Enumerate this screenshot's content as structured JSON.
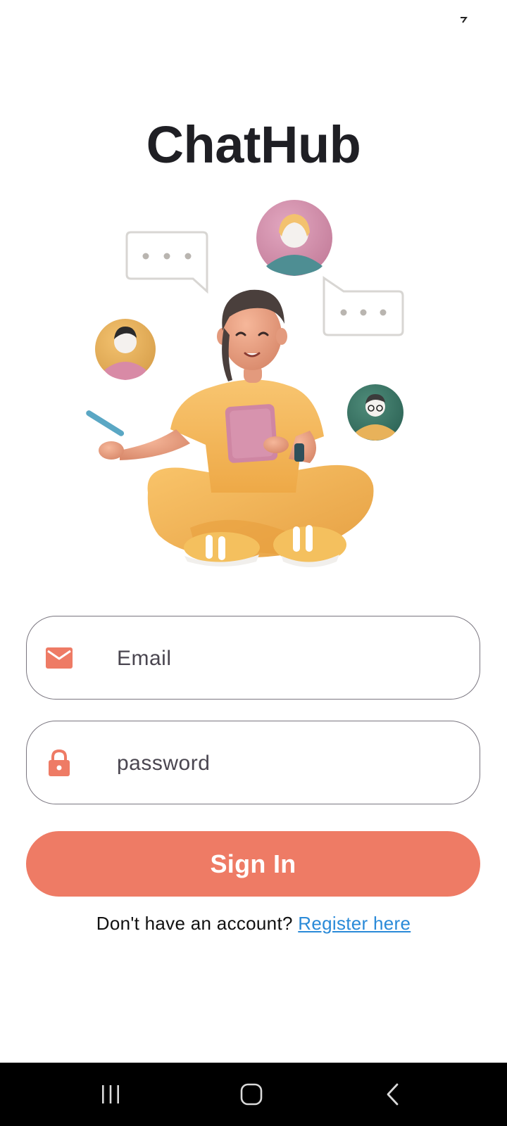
{
  "status_bar": {
    "icons": [
      "signal-icon"
    ]
  },
  "app": {
    "title": "ChatHub"
  },
  "hero": {
    "illustration": "person-with-chat-avatars-illustration"
  },
  "form": {
    "email": {
      "icon": "mail-icon",
      "placeholder": "Email",
      "value": ""
    },
    "password": {
      "icon": "lock-icon",
      "placeholder": "password",
      "value": ""
    },
    "submit_label": "Sign In"
  },
  "register": {
    "prompt": "Don't have an account? ",
    "link_label": "Register here"
  },
  "nav_bar": {
    "buttons": [
      "recents-icon",
      "home-icon",
      "back-icon"
    ]
  },
  "colors": {
    "accent": "#ee7b65",
    "link": "#2a8ad8",
    "title": "#1f1f24",
    "field_border": "#79757f",
    "nav_background": "#000000"
  }
}
